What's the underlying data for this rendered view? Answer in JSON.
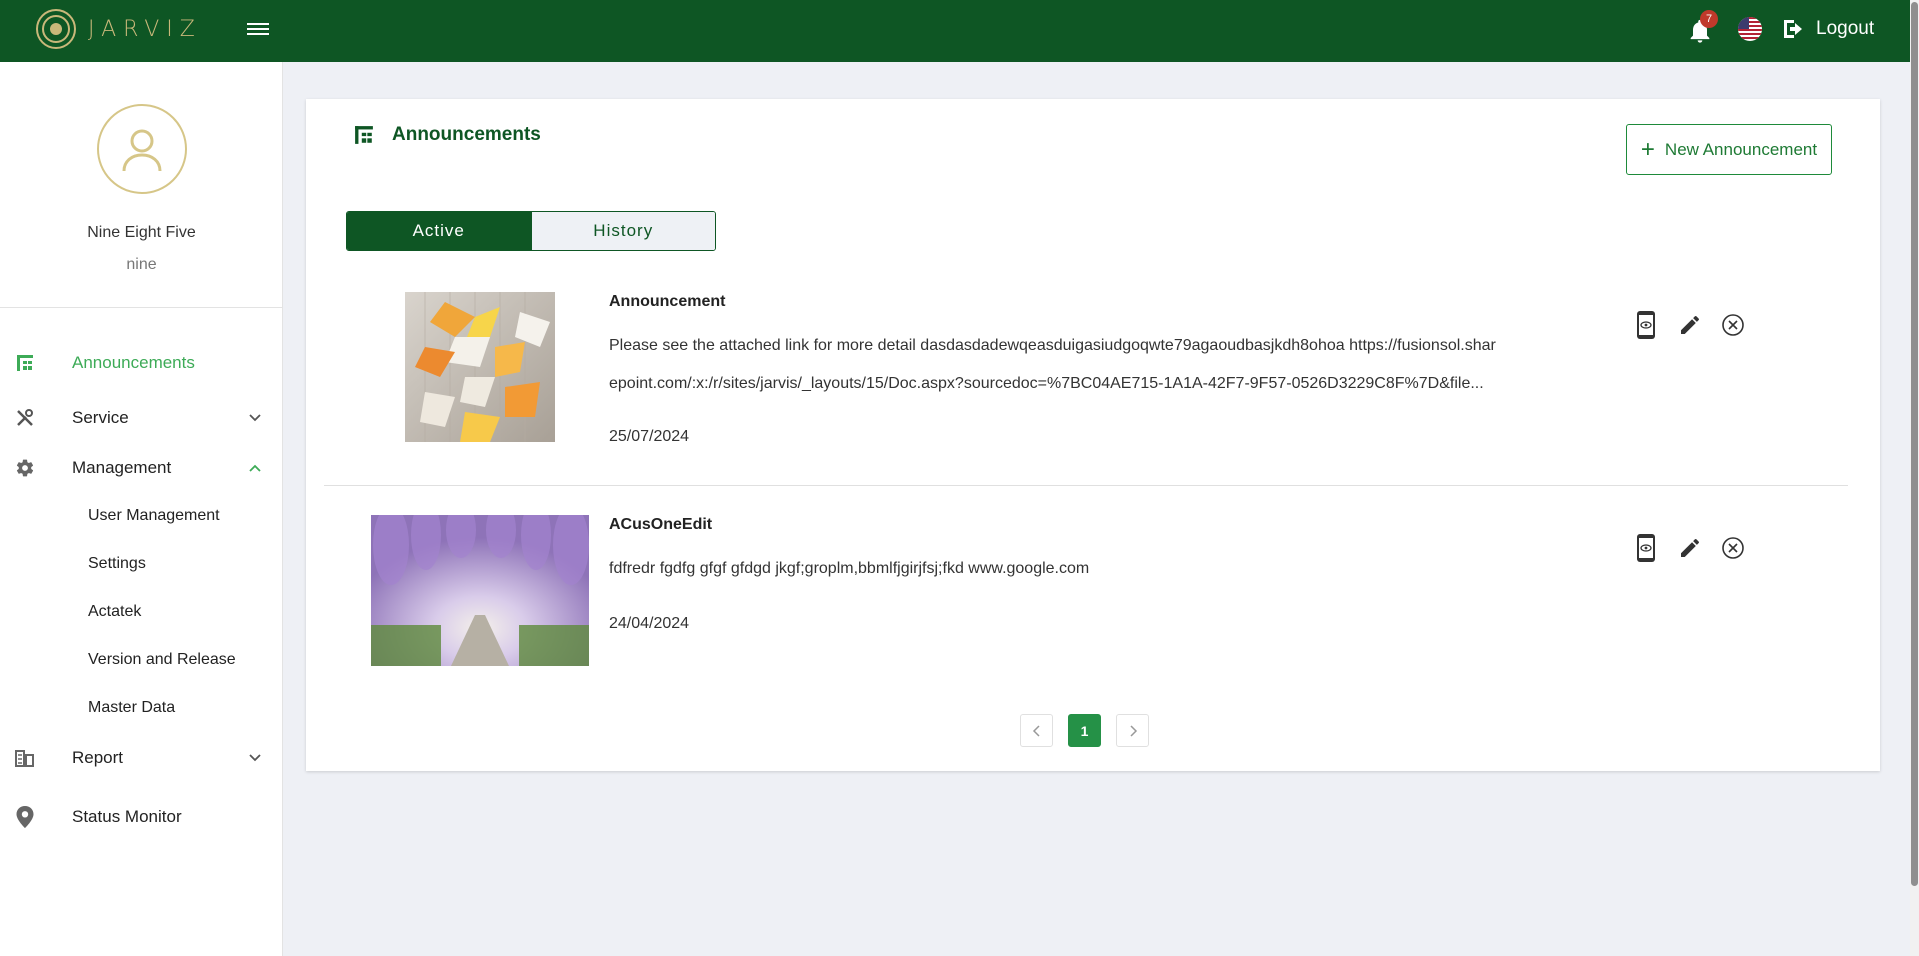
{
  "app": {
    "brand": "JARVIZ"
  },
  "header": {
    "notification_count": "7",
    "logout_label": "Logout"
  },
  "user": {
    "name": "Nine Eight Five",
    "subtitle": "nine"
  },
  "sidebar": {
    "items": [
      {
        "label": "Announcements",
        "icon": "announcements-icon",
        "active": true
      },
      {
        "label": "Service",
        "icon": "tools-icon",
        "expanded": false
      },
      {
        "label": "Management",
        "icon": "gear-icon",
        "expanded": true
      },
      {
        "label": "Report",
        "icon": "report-icon",
        "expanded": false
      },
      {
        "label": "Status Monitor",
        "icon": "location-pin-icon"
      }
    ],
    "management_sub": [
      "User Management",
      "Settings",
      "Actatek",
      "Version and Release",
      "Master Data"
    ]
  },
  "main": {
    "title": "Announcements",
    "new_button_label": "New Announcement",
    "tabs": [
      {
        "label": "Active",
        "active": true
      },
      {
        "label": "History",
        "active": false
      }
    ],
    "announcements": [
      {
        "title": "Announcement",
        "body_line1": "Please see the attached link for more detail dasdasdadewqeasduigasiudgoqwte79agaoudbasjkdh8ohoa https://fusionsol.shar",
        "body_line2": "epoint.com/:x:/r/sites/jarvis/_layouts/15/Doc.aspx?sourcedoc=%7BC04AE715-1A1A-42F7-9F57-0526D3229C8F%7D&file...",
        "date": "25/07/2024"
      },
      {
        "title": "ACusOneEdit",
        "body_line1": "fdfredr fgdfg gfgf gfdgd jkgf;groplm,bbmlfjgirjfsj;fkd www.google.com",
        "date": "24/04/2024"
      }
    ],
    "pagination": {
      "current": "1"
    }
  },
  "colors": {
    "header": "#0e5624",
    "accent": "#3dab57",
    "gold": "#c9b87a"
  }
}
